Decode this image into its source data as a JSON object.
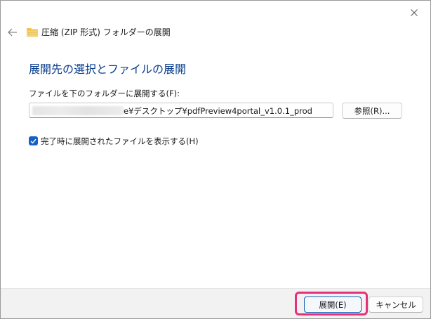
{
  "window": {
    "title": "圧縮 (ZIP 形式) フォルダーの展開"
  },
  "main": {
    "heading": "展開先の選択とファイルの展開",
    "path_label": "ファイルを下のフォルダーに展開する(F):",
    "path_value": "e¥デスクトップ¥pdfPreview4portal_v1.0.1_prod",
    "browse_label": "参照(R)...",
    "checkbox_label": "完了時に展開されたファイルを表示する(H)",
    "checkbox_checked": true
  },
  "footer": {
    "extract_label": "展開(E)",
    "cancel_label": "キャンセル"
  },
  "colors": {
    "heading": "#0a3e8c",
    "accent": "#1462c8",
    "highlight": "#e8307a"
  },
  "icons": {
    "back": "back-arrow-icon",
    "folder": "zip-folder-icon",
    "close": "close-icon",
    "check": "checkmark-icon"
  }
}
